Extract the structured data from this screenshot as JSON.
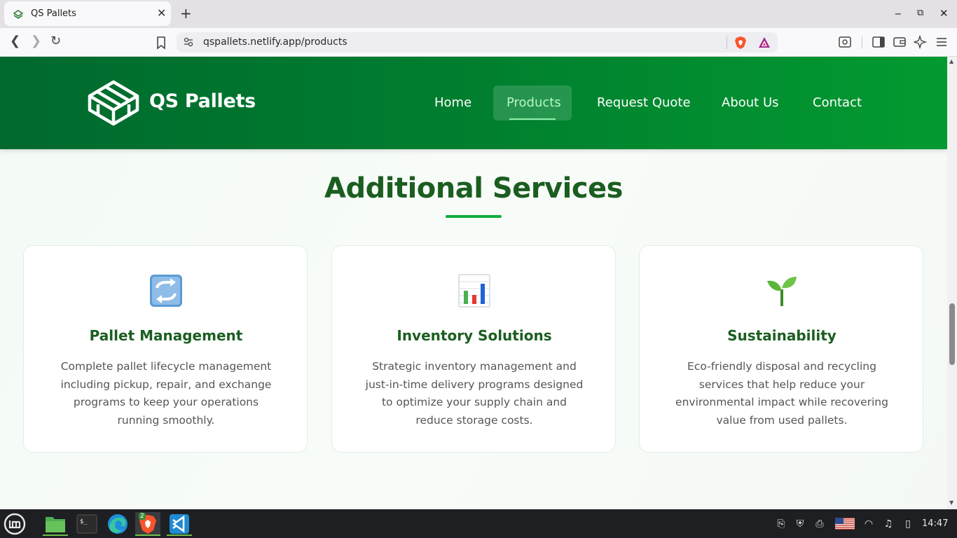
{
  "browser": {
    "tab_title": "QS Pallets",
    "url": "qspallets.netlify.app/products"
  },
  "site": {
    "logo_text": "QS Pallets",
    "nav": [
      {
        "label": "Home"
      },
      {
        "label": "Products"
      },
      {
        "label": "Request Quote"
      },
      {
        "label": "About Us"
      },
      {
        "label": "Contact"
      }
    ],
    "active_nav": "Products"
  },
  "section": {
    "title": "Additional Services",
    "cards": [
      {
        "icon": "recycle-arrows-icon",
        "title": "Pallet Management",
        "description": "Complete pallet lifecycle management including pickup, repair, and exchange programs to keep your operations running smoothly."
      },
      {
        "icon": "bar-chart-icon",
        "title": "Inventory Solutions",
        "description": "Strategic inventory management and just-in-time delivery programs designed to optimize your supply chain and reduce storage costs."
      },
      {
        "icon": "seedling-icon",
        "title": "Sustainability",
        "description": "Eco-friendly disposal and recycling services that help reduce your environmental impact while recovering value from used pallets."
      }
    ]
  },
  "taskbar": {
    "clock": "14:47",
    "brave_badge": "2"
  },
  "colors": {
    "header_start": "#00692e",
    "header_end": "#039a30",
    "title_green": "#1b5e20",
    "accent_green": "#0fae3b"
  }
}
